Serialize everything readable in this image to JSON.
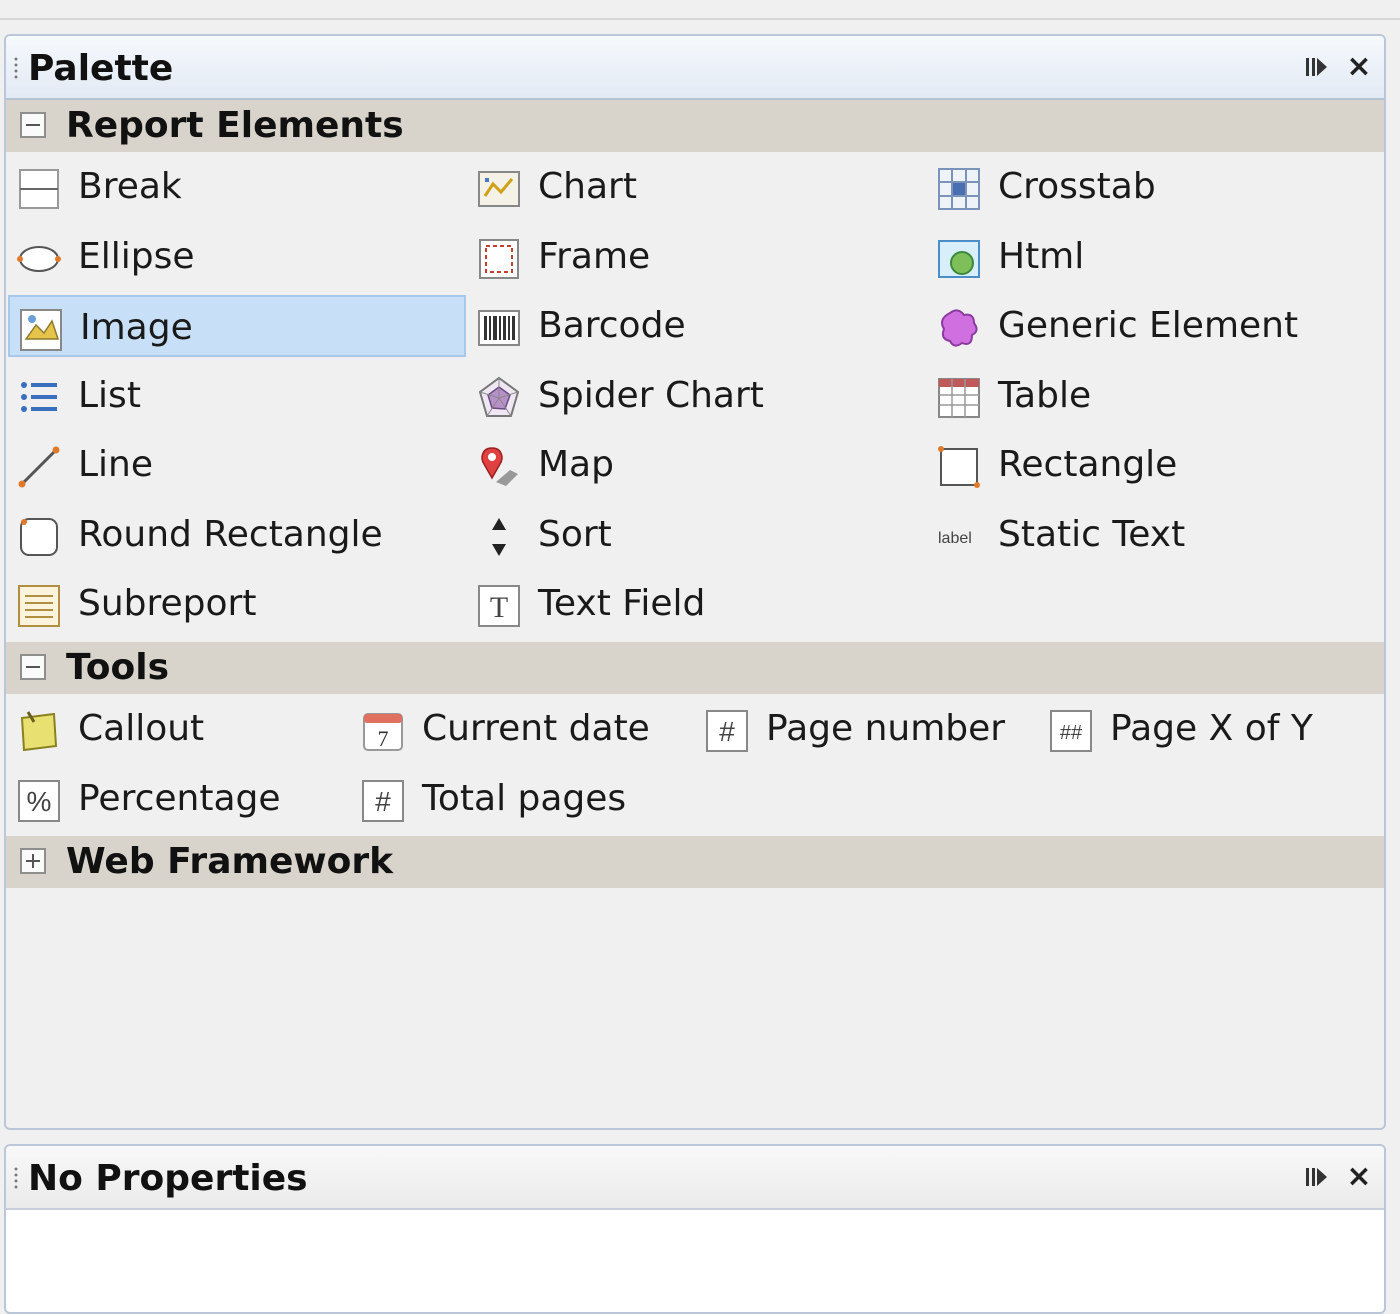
{
  "palette": {
    "title": "Palette",
    "categories": [
      {
        "label": "Report Elements",
        "expanded": true,
        "items": [
          {
            "label": "Break",
            "icon": "break-icon"
          },
          {
            "label": "Chart",
            "icon": "chart-icon"
          },
          {
            "label": "Crosstab",
            "icon": "crosstab-icon"
          },
          {
            "label": "Ellipse",
            "icon": "ellipse-icon"
          },
          {
            "label": "Frame",
            "icon": "frame-icon"
          },
          {
            "label": "Html",
            "icon": "html-icon"
          },
          {
            "label": "Image",
            "icon": "image-icon",
            "selected": true
          },
          {
            "label": "Barcode",
            "icon": "barcode-icon"
          },
          {
            "label": "Generic Element",
            "icon": "generic-element-icon"
          },
          {
            "label": "List",
            "icon": "list-icon"
          },
          {
            "label": "Spider Chart",
            "icon": "spider-chart-icon"
          },
          {
            "label": "Table",
            "icon": "table-icon"
          },
          {
            "label": "Line",
            "icon": "line-icon"
          },
          {
            "label": "Map",
            "icon": "map-icon"
          },
          {
            "label": "Rectangle",
            "icon": "rectangle-icon"
          },
          {
            "label": "Round Rectangle",
            "icon": "round-rectangle-icon"
          },
          {
            "label": "Sort",
            "icon": "sort-icon"
          },
          {
            "label": "Static Text",
            "icon": "static-text-icon"
          },
          {
            "label": "Subreport",
            "icon": "subreport-icon"
          },
          {
            "label": "Text Field",
            "icon": "text-field-icon"
          }
        ]
      },
      {
        "label": "Tools",
        "expanded": true,
        "items": [
          {
            "label": "Callout",
            "icon": "callout-icon"
          },
          {
            "label": "Current date",
            "icon": "calendar-icon"
          },
          {
            "label": "Page number",
            "icon": "page-number-icon"
          },
          {
            "label": "Page X of Y",
            "icon": "page-x-of-y-icon"
          },
          {
            "label": "Percentage",
            "icon": "percentage-icon"
          },
          {
            "label": "Total pages",
            "icon": "total-pages-icon"
          }
        ]
      },
      {
        "label": "Web Framework",
        "expanded": false,
        "items": []
      }
    ]
  },
  "properties": {
    "title": "No Properties"
  },
  "colors": {
    "selection": "#c8e0f7",
    "category_bg": "#d8d4cc",
    "title_gradient_top": "#f6f9fd"
  }
}
